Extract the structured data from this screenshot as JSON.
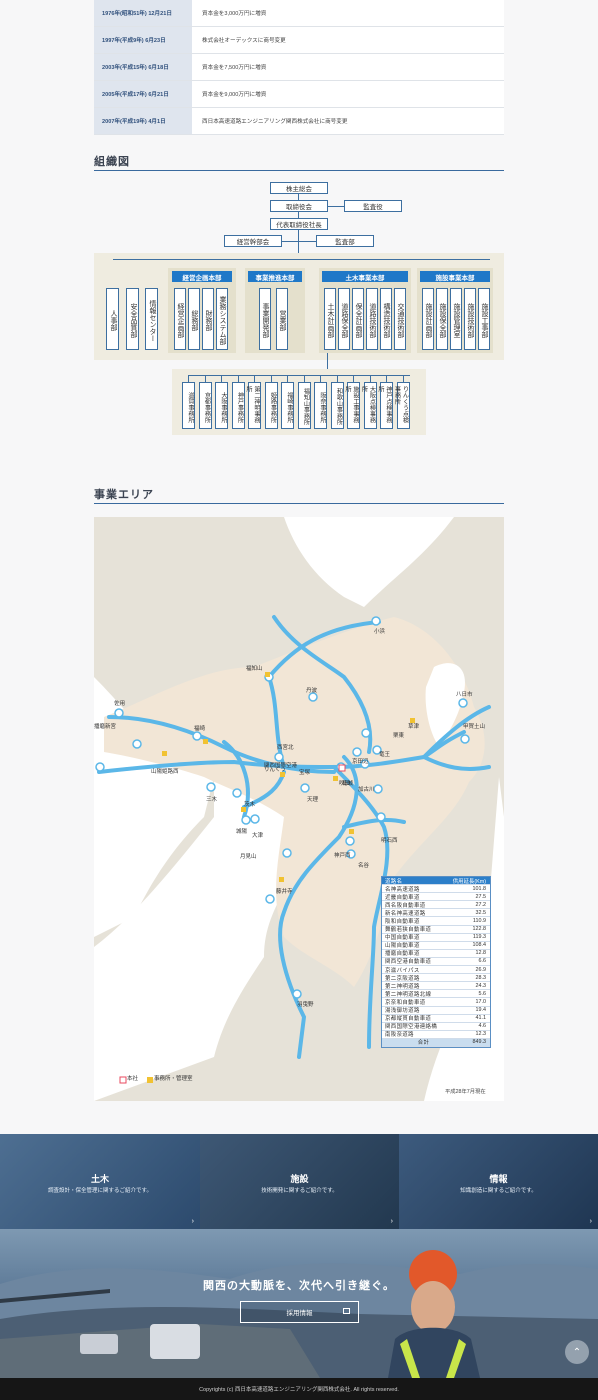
{
  "history": [
    {
      "date": "1976年(昭和51年) 12月21日",
      "desc": "資本金を3,000万円に増資"
    },
    {
      "date": "1997年(平成9年) 6月23日",
      "desc": "株式会社オーデックスに商号変更"
    },
    {
      "date": "2003年(平成15年) 6月18日",
      "desc": "資本金を7,500万円に増資"
    },
    {
      "date": "2005年(平成17年) 6月21日",
      "desc": "資本金を9,000万円に増資"
    },
    {
      "date": "2007年(平成19年) 4月1日",
      "desc": "西日本高速道路エンジニアリング関西株式会社に商号変更"
    }
  ],
  "org": {
    "title": "組織図",
    "top": {
      "shareholders": "株主総会",
      "board": "取締役会",
      "auditor": "監査役",
      "president": "代表取締役社長",
      "mgmt_council": "経営幹部会",
      "audit_dept": "監査部"
    },
    "staff_depts": [
      "人事部",
      "安全品質部",
      "情報センター"
    ],
    "divisions": [
      {
        "name": "経営企画本部",
        "depts": [
          "経営企画部",
          "総務部",
          "財務部",
          "業務システム部"
        ]
      },
      {
        "name": "事業推進本部",
        "depts": [
          "事業開発部",
          "営業部"
        ]
      },
      {
        "name": "土木事業本部",
        "depts": [
          "土木計画部",
          "道路保全部",
          "保全計画部",
          "道路技術部",
          "構造技術部",
          "交通技術部"
        ]
      },
      {
        "name": "施設事業本部",
        "depts": [
          "施設計画部",
          "施設保全部",
          "施設管理室",
          "施設技術部",
          "施設工事部"
        ]
      }
    ],
    "offices": [
      "滋賀事務所",
      "京都事務所",
      "大阪事務所",
      "神戸事務所",
      "第二神明事務所",
      "姫路事務所",
      "福崎事務所",
      "福知山事務所",
      "阪奈事務所",
      "和歌山事務所",
      "施設工事事務所",
      "大阪点検事務所",
      "神戸点検事務所",
      "りんくう点検事務所"
    ]
  },
  "area": {
    "title": "事業エリア",
    "places": [
      "小浜",
      "福知山",
      "丹波",
      "八日市",
      "甲賀土山",
      "栗東",
      "草津",
      "吹田",
      "京田辺",
      "佐用",
      "播磨新宮",
      "山陽姫路西",
      "福崎",
      "西宮北",
      "宝塚",
      "三木",
      "茨木",
      "城陽",
      "大津",
      "竜王",
      "加古川",
      "明石西",
      "神戸西",
      "名谷",
      "月見山",
      "藤井寺",
      "羽曳野",
      "天理",
      "葛城",
      "関西国際空港",
      "りんくう",
      "和歌山",
      "南紀田辺",
      "西宮",
      "本社",
      "姫路",
      "三田西"
    ],
    "legend_hq": "本社",
    "legend_office": "事務所・管理室",
    "routes_header": {
      "name": "道路名",
      "length": "供用延長(Km)"
    },
    "routes": [
      {
        "name": "名神高速道路",
        "km": "101.8"
      },
      {
        "name": "近畿自動車道",
        "km": "27.5"
      },
      {
        "name": "西名阪自動車道",
        "km": "27.2"
      },
      {
        "name": "新名神高速道路",
        "km": "32.5"
      },
      {
        "name": "阪和自動車道",
        "km": "110.9"
      },
      {
        "name": "舞鶴若狭自動車道",
        "km": "122.8"
      },
      {
        "name": "中国自動車道",
        "km": "119.3"
      },
      {
        "name": "山陽自動車道",
        "km": "108.4"
      },
      {
        "name": "播磨自動車道",
        "km": "12.8"
      },
      {
        "name": "関西空港自動車道",
        "km": "6.6"
      },
      {
        "name": "京滋バイパス",
        "km": "26.9"
      },
      {
        "name": "第二京阪道路",
        "km": "28.3"
      },
      {
        "name": "第二神明道路",
        "km": "24.3"
      },
      {
        "name": "第二神明道路北線",
        "km": "5.6"
      },
      {
        "name": "京奈和自動車道",
        "km": "17.0"
      },
      {
        "name": "湯浅御坊道路",
        "km": "19.4"
      },
      {
        "name": "京都縦貫自動車道",
        "km": "41.1"
      },
      {
        "name": "関西国際空港連絡橋",
        "km": "4.6"
      },
      {
        "name": "南阪奈道路",
        "km": "12.3"
      }
    ],
    "total_label": "合計",
    "total_km": "849.3",
    "as_of": "平成28年7月現在"
  },
  "promos": [
    {
      "title": "土木",
      "sub": "調査設計・保全管理に関するご紹介です。"
    },
    {
      "title": "施設",
      "sub": "技術開発に関するご紹介です。"
    },
    {
      "title": "情報",
      "sub": "知識創造に関するご紹介です。"
    }
  ],
  "recruit": {
    "catch": "関西の大動脈を、次代へ引き継ぐ。",
    "button": "採用情報",
    "button_icon": "external-link-icon"
  },
  "footer": {
    "copyright": "Copyrights (c) 西日本高速道路エンジニアリング関西株式会社. All rights reserved."
  },
  "colors": {
    "accent": "#1f78c8",
    "road": "#5bb7e8",
    "land": "#f2e6d6",
    "office": "#f1c232",
    "hq": "#e84a5f"
  }
}
